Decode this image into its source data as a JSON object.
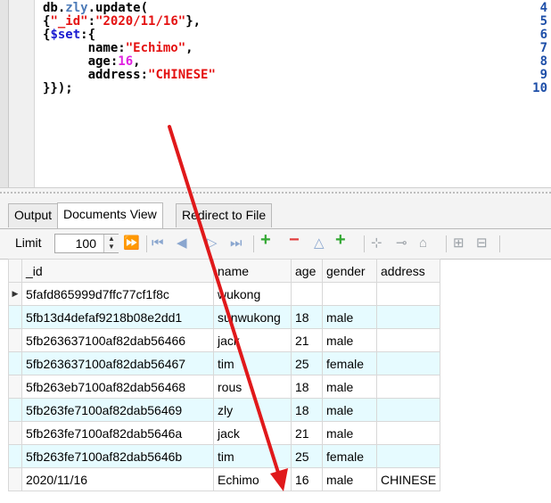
{
  "editor": {
    "line_numbers": [
      "4",
      "5",
      "6",
      "7",
      "8",
      "9",
      "10"
    ],
    "lines": [
      {
        "parts": [
          {
            "t": "db.",
            "c": "k"
          },
          {
            "t": "zly",
            "c": "fn"
          },
          {
            "t": ".update(",
            "c": "k"
          }
        ]
      },
      {
        "parts": [
          {
            "t": "{",
            "c": "k"
          },
          {
            "t": "\"_id\"",
            "c": "str"
          },
          {
            "t": ":",
            "c": "k"
          },
          {
            "t": "\"2020/11/16\"",
            "c": "str"
          },
          {
            "t": "},",
            "c": "k"
          }
        ]
      },
      {
        "parts": [
          {
            "t": "{",
            "c": "k"
          },
          {
            "t": "$set",
            "c": "set"
          },
          {
            "t": ":{",
            "c": "k"
          }
        ]
      },
      {
        "parts": [
          {
            "t": "      name:",
            "c": "k"
          },
          {
            "t": "\"Echimo\"",
            "c": "str"
          },
          {
            "t": ",",
            "c": "k"
          }
        ]
      },
      {
        "parts": [
          {
            "t": "      age:",
            "c": "k"
          },
          {
            "t": "16",
            "c": "num"
          },
          {
            "t": ",",
            "c": "k"
          }
        ]
      },
      {
        "parts": [
          {
            "t": "      address:",
            "c": "k"
          },
          {
            "t": "\"CHINESE\"",
            "c": "str"
          }
        ]
      },
      {
        "parts": [
          {
            "t": "}});",
            "c": "k"
          }
        ]
      }
    ]
  },
  "tabs": [
    {
      "label": "Output",
      "active": false
    },
    {
      "label": "Documents View",
      "active": true
    },
    {
      "label": "Redirect to File",
      "active": false
    }
  ],
  "toolbar": {
    "limit_label": "Limit",
    "limit_value": "100"
  },
  "grid": {
    "columns": [
      "_id",
      "name",
      "age",
      "gender",
      "address"
    ],
    "rows": [
      {
        "id": "5fafd865999d7ffc77cf1f8c",
        "name": "wukong",
        "age": "",
        "gender": "",
        "address": "",
        "current": true
      },
      {
        "id": "5fb13d4defaf9218b08e2dd1",
        "name": "sunwukong",
        "age": "18",
        "gender": "male",
        "address": ""
      },
      {
        "id": "5fb263637100af82dab56466",
        "name": "jack",
        "age": "21",
        "gender": "male",
        "address": ""
      },
      {
        "id": "5fb263637100af82dab56467",
        "name": "tim",
        "age": "25",
        "gender": "female",
        "address": ""
      },
      {
        "id": "5fb263eb7100af82dab56468",
        "name": "rous",
        "age": "18",
        "gender": "male",
        "address": ""
      },
      {
        "id": "5fb263fe7100af82dab56469",
        "name": "zly",
        "age": "18",
        "gender": "male",
        "address": ""
      },
      {
        "id": "5fb263fe7100af82dab5646a",
        "name": "jack",
        "age": "21",
        "gender": "male",
        "address": ""
      },
      {
        "id": "5fb263fe7100af82dab5646b",
        "name": "tim",
        "age": "25",
        "gender": "female",
        "address": ""
      },
      {
        "id": "2020/11/16",
        "name": "Echimo",
        "age": "16",
        "gender": "male",
        "address": "CHINESE"
      }
    ]
  },
  "colors": {
    "row_alt": "#e6fbff",
    "annotation_arrow": "#e0191b",
    "string": "#e41010",
    "number": "#e020e0"
  }
}
